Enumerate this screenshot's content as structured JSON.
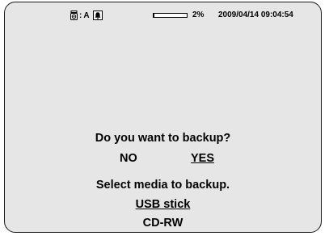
{
  "status": {
    "camera_label": "A",
    "alarm_icon": "bell-icon",
    "progress_percent": 2,
    "progress_text": "2%",
    "datetime": "2009/04/14 09:04:54"
  },
  "dialog": {
    "question": "Do you want to backup?",
    "no_label": "NO",
    "yes_label": "YES",
    "selected_option": "YES"
  },
  "media": {
    "prompt": "Select media to backup.",
    "options": [
      "USB stick",
      "CD-RW"
    ],
    "selected": "USB stick"
  }
}
